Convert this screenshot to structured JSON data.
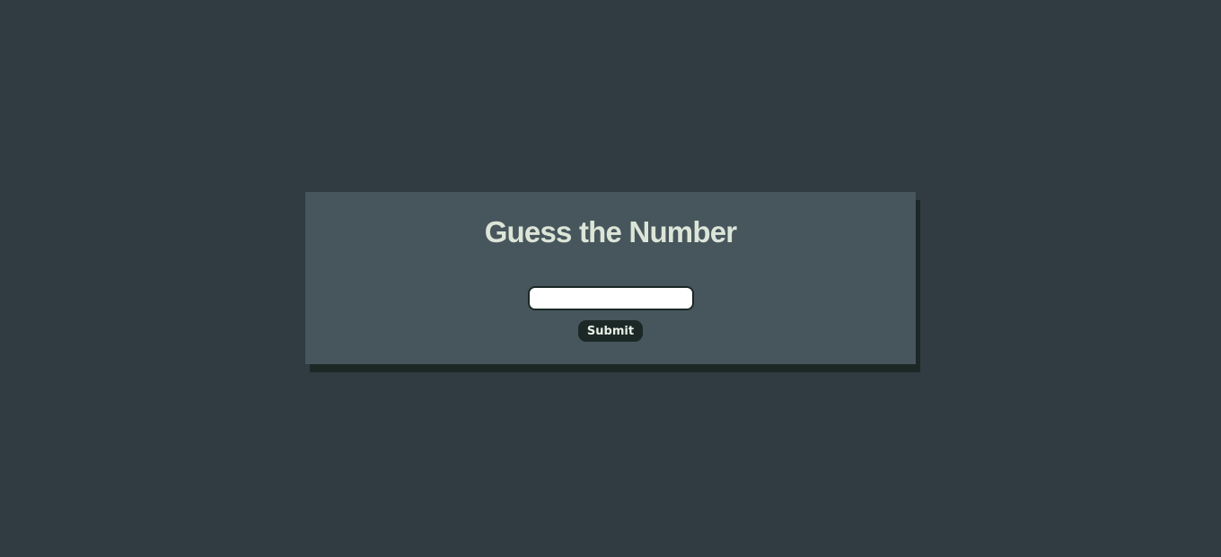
{
  "title": "Guess the Number",
  "guess_input": {
    "value": "",
    "placeholder": ""
  },
  "submit_label": "Submit",
  "colors": {
    "background": "#303b42",
    "card": "#47565c",
    "accent": "#1b2826",
    "title": "#dce5d8"
  }
}
